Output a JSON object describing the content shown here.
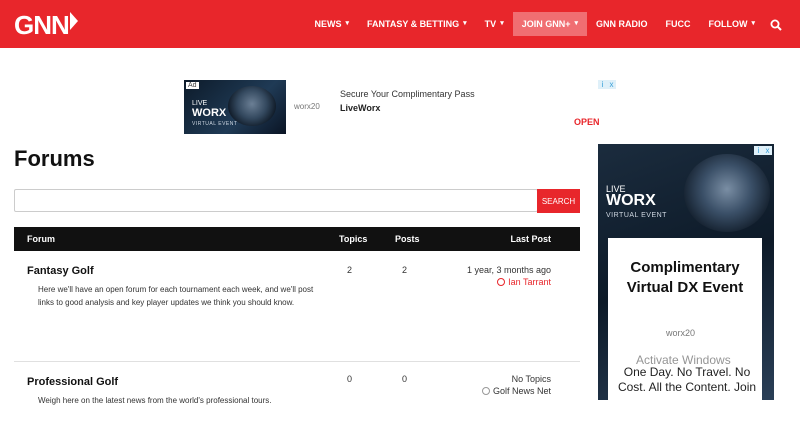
{
  "header": {
    "logo_text": "GNN",
    "nav": [
      {
        "label": "NEWS",
        "caret": true
      },
      {
        "label": "FANTASY & BETTING",
        "caret": true
      },
      {
        "label": "TV",
        "caret": true
      },
      {
        "label": "JOIN GNN+",
        "caret": true,
        "active": true
      },
      {
        "label": "GNN RADIO",
        "caret": false
      },
      {
        "label": "FUCC",
        "caret": false
      },
      {
        "label": "FOLLOW",
        "caret": true
      }
    ],
    "search_icon": "search-icon"
  },
  "top_ad": {
    "badge": "Ad",
    "image_live": "LIVE",
    "image_worx": "WORX",
    "image_event": "VIRTUAL EVENT",
    "logo_text": "worx20",
    "headline": "Secure Your Complimentary Pass",
    "advertiser": "LiveWorx",
    "cta": "OPEN",
    "choices": [
      "i",
      "x"
    ]
  },
  "page": {
    "title": "Forums",
    "search_button": "SEARCH",
    "search_placeholder": ""
  },
  "table": {
    "headers": {
      "forum": "Forum",
      "topics": "Topics",
      "posts": "Posts",
      "last_post": "Last Post"
    },
    "rows": [
      {
        "name": "Fantasy Golf",
        "description": "Here we'll have an open forum for each tournament each week, and we'll post links to good analysis and key player updates we think you should know.",
        "topics": "2",
        "posts": "2",
        "last_time": "1 year, 3 months ago",
        "last_user": "Ian Tarrant"
      },
      {
        "name": "Professional Golf",
        "description": "Weigh here on the latest news from the world's professional tours.",
        "topics": "0",
        "posts": "0",
        "last_time": "No Topics",
        "last_user": "Golf News Net"
      }
    ]
  },
  "side_ad": {
    "live": "LIVE",
    "worx": "WORX",
    "event": "VIRTUAL EVENT",
    "card_title_line1": "Complimentary",
    "card_title_line2": "Virtual DX Event",
    "card_logo": "worx20",
    "card_text_line1": "One Day. No Travel. No",
    "card_text_line2": "Cost. All the Content. Join",
    "choices": [
      "i",
      "x"
    ]
  },
  "watermark": {
    "line1": "Activate Windows"
  },
  "colors": {
    "brand_red": "#e8262b",
    "table_header": "#111111"
  }
}
